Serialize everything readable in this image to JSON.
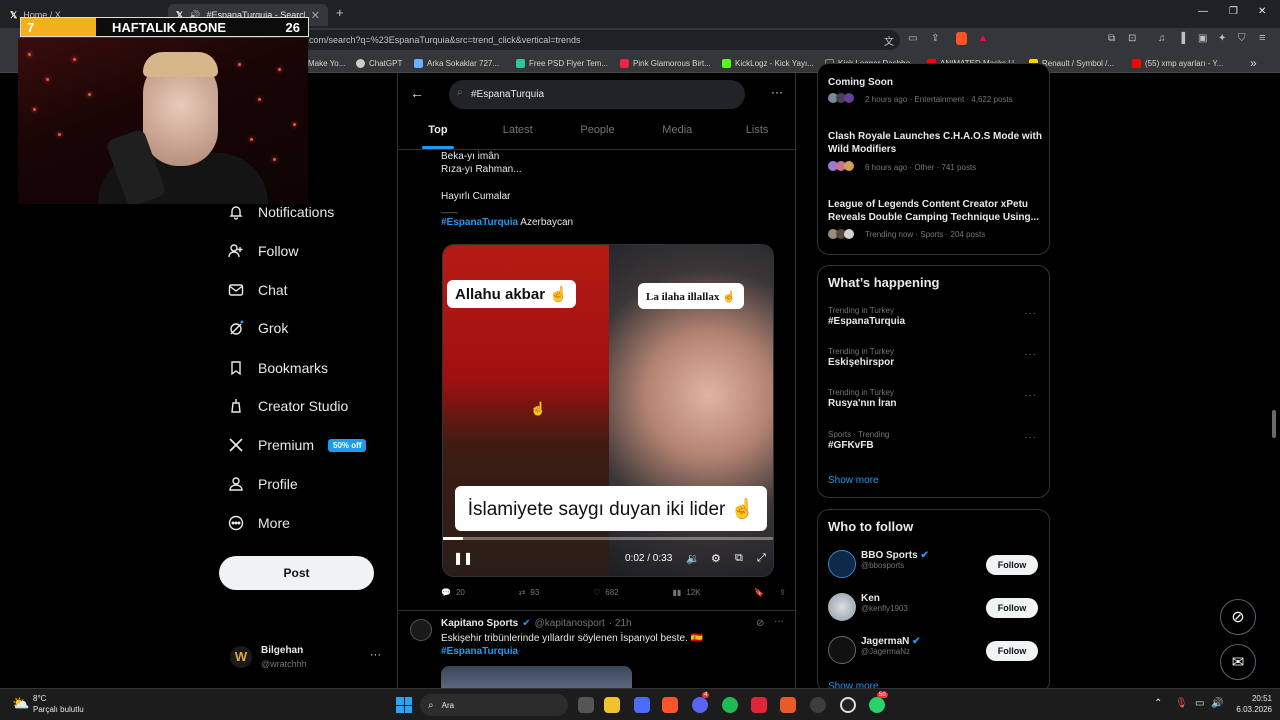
{
  "browser": {
    "tabs": [
      {
        "label": "Home / X"
      },
      {
        "label": "#EspanaTurquia - Search / X"
      }
    ],
    "url": "x.com/search?q=%23EspanaTurquia&src=trend_click&vertical=trends",
    "bookmarks": [
      "Make Yo...",
      "ChatGPT",
      "Arka Sokaklar 727...",
      "Free PSD Flyer Tem...",
      "Pink Glamorous Birt...",
      "KickLogz - Kick Yayı...",
      "Kick Logger Dashbo...",
      "ANIMATED Masks U...",
      "Renault / Symbol /...",
      "(55) xmp ayarları - Y..."
    ]
  },
  "overlay": {
    "left": "7",
    "title": "HAFTALIK ABONE",
    "right": "26"
  },
  "nav": {
    "items": [
      {
        "label": "Notifications"
      },
      {
        "label": "Follow"
      },
      {
        "label": "Chat"
      },
      {
        "label": "Grok"
      },
      {
        "label": "Bookmarks"
      },
      {
        "label": "Creator Studio"
      },
      {
        "label": "Premium"
      },
      {
        "label": "Profile"
      },
      {
        "label": "More"
      }
    ],
    "premium_badge": "50% off",
    "post_label": "Post",
    "user": {
      "name": "Bilgehan",
      "handle": "@wratchhh"
    }
  },
  "search": {
    "query": "#EspanaTurquia",
    "tabs": [
      "Top",
      "Latest",
      "People",
      "Media",
      "Lists"
    ]
  },
  "post1": {
    "lines": [
      "Beka-yı imân",
      "Rıza-yı Rahman...",
      "Hayırlı Cumalar",
      "___"
    ],
    "hashtag": "#EspanaTurquia",
    "location": "Azerbaycan",
    "video": {
      "label_left": "Allahu akbar ☝",
      "label_right": "La ilaha illallax ☝",
      "caption": "İslamiyete saygı duyan iki lider ☝",
      "time": "0:02 / 0:33",
      "progress": 0.06
    },
    "stats": {
      "replies": "20",
      "reposts": "93",
      "likes": "682",
      "views": "12K"
    }
  },
  "post2": {
    "name": "Kapitano Sports",
    "handle": "@kapitanosport",
    "time": "· 21h",
    "text": "Eskişehir tribünlerinde yıllardır söylenen İspanyol beste. 🇪🇸",
    "hashtag": "#EspanaTurquia"
  },
  "news": [
    {
      "title": "Coming Soon",
      "meta": "2 hours ago · Entertainment · 4,622 posts"
    },
    {
      "title": "Clash Royale Launches C.H.A.O.S Mode with Wild Modifiers",
      "meta": "6 hours ago · Other · 741 posts"
    },
    {
      "title": "League of Legends Content Creator xPetu Reveals Double Camping Technique Using...",
      "meta": "Trending now · Sports · 204 posts"
    }
  ],
  "happening": {
    "heading": "What’s happening",
    "trends": [
      {
        "context": "Trending in Turkey",
        "name": "#EspanaTurquia"
      },
      {
        "context": "Trending in Turkey",
        "name": "Eskişehirspor"
      },
      {
        "context": "Trending in Turkey",
        "name": "Rusya'nın İran"
      },
      {
        "context": "Sports · Trending",
        "name": "#GFKvFB"
      }
    ],
    "show_more": "Show more"
  },
  "who_to_follow": {
    "heading": "Who to follow",
    "users": [
      {
        "name": "BBO Sports",
        "handle": "@bbosports"
      },
      {
        "name": "Ken",
        "handle": "@kenfly1903"
      },
      {
        "name": "JagermaN",
        "handle": "@JagermaNz"
      }
    ],
    "follow_label": "Follow",
    "show_more": "Show more"
  },
  "taskbar": {
    "weather_temp": "8°C",
    "weather_desc": "Parçalı bulutlu",
    "search": "Ara",
    "time": "20:51",
    "date": "6.03.2026",
    "badge_discord": "4",
    "badge_whatsapp": "50"
  },
  "colors": {
    "accent": "#1d9bf0",
    "bg": "#000000",
    "border": "#2f3336",
    "muted": "#71767b"
  }
}
